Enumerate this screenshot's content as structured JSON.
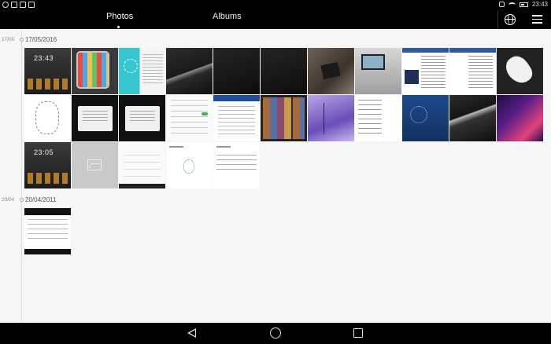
{
  "status_bar": {
    "time": "23:43",
    "left_icons": [
      "notification-icon",
      "message-icon",
      "image-notification-icon",
      "download-icon"
    ],
    "right_icons": [
      "alarm-icon",
      "wifi-icon",
      "battery-icon"
    ]
  },
  "app_bar": {
    "tabs": [
      {
        "label": "Photos",
        "selected": true
      },
      {
        "label": "Albums",
        "selected": false
      }
    ],
    "actions": [
      "globe-icon",
      "menu-icon"
    ]
  },
  "timeline": {
    "sections": [
      {
        "side_label": "17/05",
        "date": "17/05/2016",
        "thumbnails": [
          "lock-screen",
          "tablet-home",
          "cyan-app",
          "dark-wallpaper",
          "dark-screen",
          "dark-circle-screen",
          "photo-room",
          "photo-desk",
          "web-page",
          "web-page",
          "feather-wallpaper",
          "sketch",
          "dialog-dark",
          "dialog-dark",
          "settings",
          "blue-web",
          "wallpapers-grid",
          "purple-tree",
          "white-page",
          "blue-circle",
          "wave-dark",
          "magenta-wallpaper",
          "lock-screen-2",
          "image-placeholder",
          "dialpad",
          "fingerprint",
          "form"
        ]
      },
      {
        "side_label": "20/04",
        "date": "20/04/2011",
        "thumbnails": [
          "screen-2011"
        ]
      }
    ]
  },
  "lock_clock_1": "23:43",
  "lock_clock_2": "23:05",
  "nav_bar": {
    "buttons": [
      "back-icon",
      "home-icon",
      "recent-apps-icon"
    ]
  }
}
